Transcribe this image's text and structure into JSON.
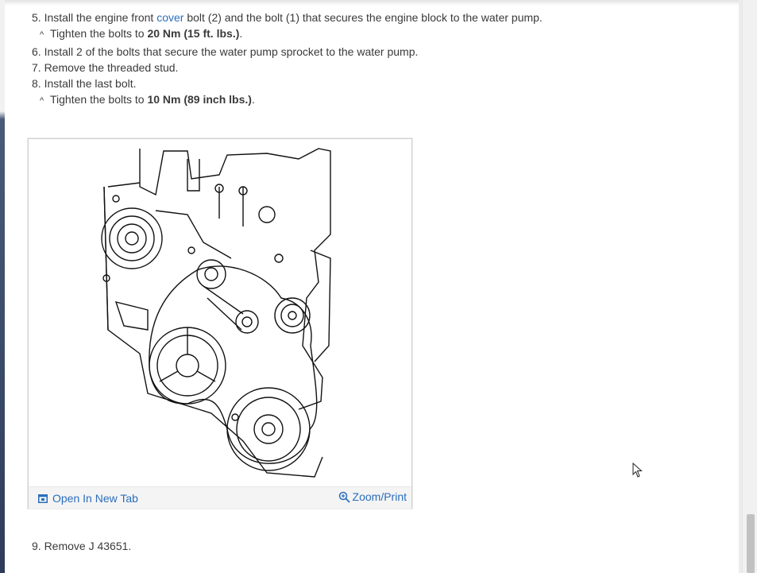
{
  "steps": {
    "s5": {
      "prefix": "5. Install the engine front ",
      "link": "cover",
      "suffix": " bolt (2) and the bolt (1) that secures the engine block to the water pump."
    },
    "s5_tighten": {
      "caret": "^",
      "text": "Tighten the bolts to ",
      "spec": "20 Nm (15 ft. lbs.)",
      "end": "."
    },
    "s6": "6. Install 2 of the bolts that secure the water pump sprocket to the water pump.",
    "s7": "7. Remove the threaded stud.",
    "s8": "8. Install the last bolt.",
    "s8_tighten": {
      "caret": "^",
      "text": "Tighten the bolts to ",
      "spec": "10 Nm (89 inch lbs.)",
      "end": "."
    },
    "s9": "9. Remove J 43651."
  },
  "figure": {
    "open_tab_label": "Open In New Tab",
    "zoom_label": "Zoom/Print",
    "icons": {
      "open_tab": "open-in-new-tab-icon",
      "zoom": "magnifier-zoom-icon"
    }
  },
  "colors": {
    "link": "#2a6ebb",
    "text": "#3a3a3a",
    "scroll_thumb": "#c1c1c1"
  }
}
